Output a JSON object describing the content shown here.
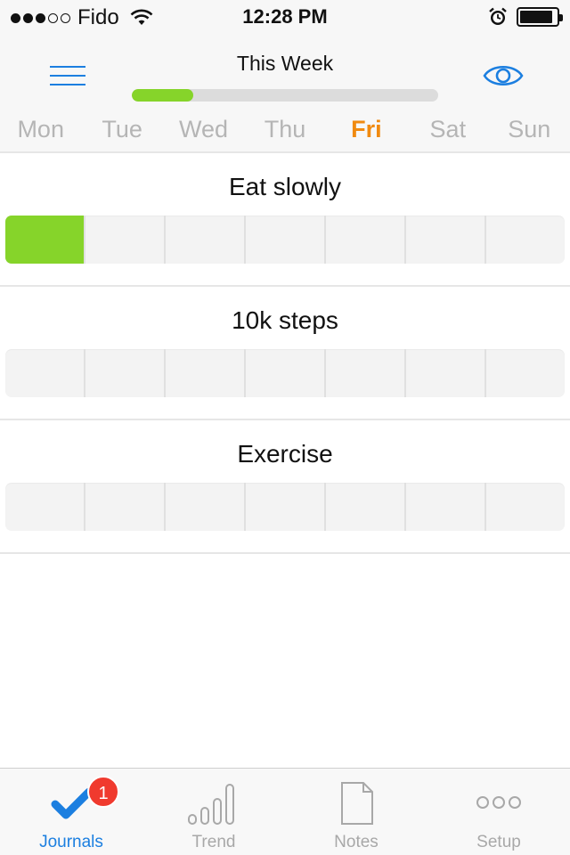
{
  "status_bar": {
    "carrier": "Fido",
    "signal_bars_filled": 3,
    "signal_bars_total": 5,
    "time": "12:28 PM",
    "battery_level": 0.9
  },
  "header": {
    "title": "This Week",
    "week_progress": 0.2,
    "menu_icon": "menu-icon",
    "eye_icon": "eye-icon"
  },
  "days": [
    {
      "label": "Mon",
      "active": false
    },
    {
      "label": "Tue",
      "active": false
    },
    {
      "label": "Wed",
      "active": false
    },
    {
      "label": "Thu",
      "active": false
    },
    {
      "label": "Fri",
      "active": true
    },
    {
      "label": "Sat",
      "active": false
    },
    {
      "label": "Sun",
      "active": false
    }
  ],
  "habits": [
    {
      "name": "Eat slowly",
      "done": [
        true,
        false,
        false,
        false,
        false,
        false,
        false
      ]
    },
    {
      "name": "10k steps",
      "done": [
        false,
        false,
        false,
        false,
        false,
        false,
        false
      ]
    },
    {
      "name": "Exercise",
      "done": [
        false,
        false,
        false,
        false,
        false,
        false,
        false
      ]
    }
  ],
  "tabbar": {
    "tabs": [
      {
        "label": "Journals",
        "icon": "checkmark-icon",
        "active": true,
        "badge": "1"
      },
      {
        "label": "Trend",
        "icon": "bars-icon",
        "active": false
      },
      {
        "label": "Notes",
        "icon": "document-icon",
        "active": false
      },
      {
        "label": "Setup",
        "icon": "ellipsis-icon",
        "active": false
      }
    ]
  },
  "colors": {
    "accent_blue": "#1c7fe0",
    "active_day_orange": "#f08a10",
    "done_green": "#86d42a",
    "badge_red": "#f03a2e"
  }
}
